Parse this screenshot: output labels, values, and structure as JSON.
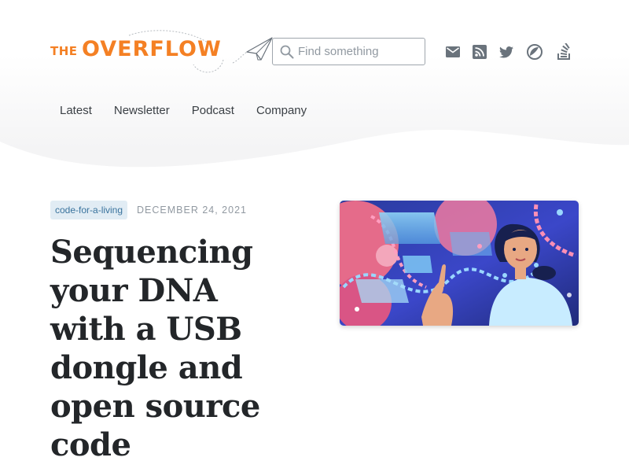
{
  "header": {
    "logo_the": "THE",
    "logo_main": "OVERFLOW",
    "search_placeholder": "Find something",
    "social_icons": [
      "mail-icon",
      "rss-icon",
      "twitter-icon",
      "podcast-icon",
      "stackoverflow-icon"
    ]
  },
  "nav": {
    "items": [
      "Latest",
      "Newsletter",
      "Podcast",
      "Company"
    ]
  },
  "article": {
    "tag": "code-for-a-living",
    "date": "DECEMBER 24, 2021",
    "title": "Sequencing your DNA with a USB dongle and open source code"
  },
  "colors": {
    "accent": "#f48024",
    "tag_bg": "#e1ecf4",
    "tag_text": "#39739d",
    "icon": "#6a737c"
  }
}
